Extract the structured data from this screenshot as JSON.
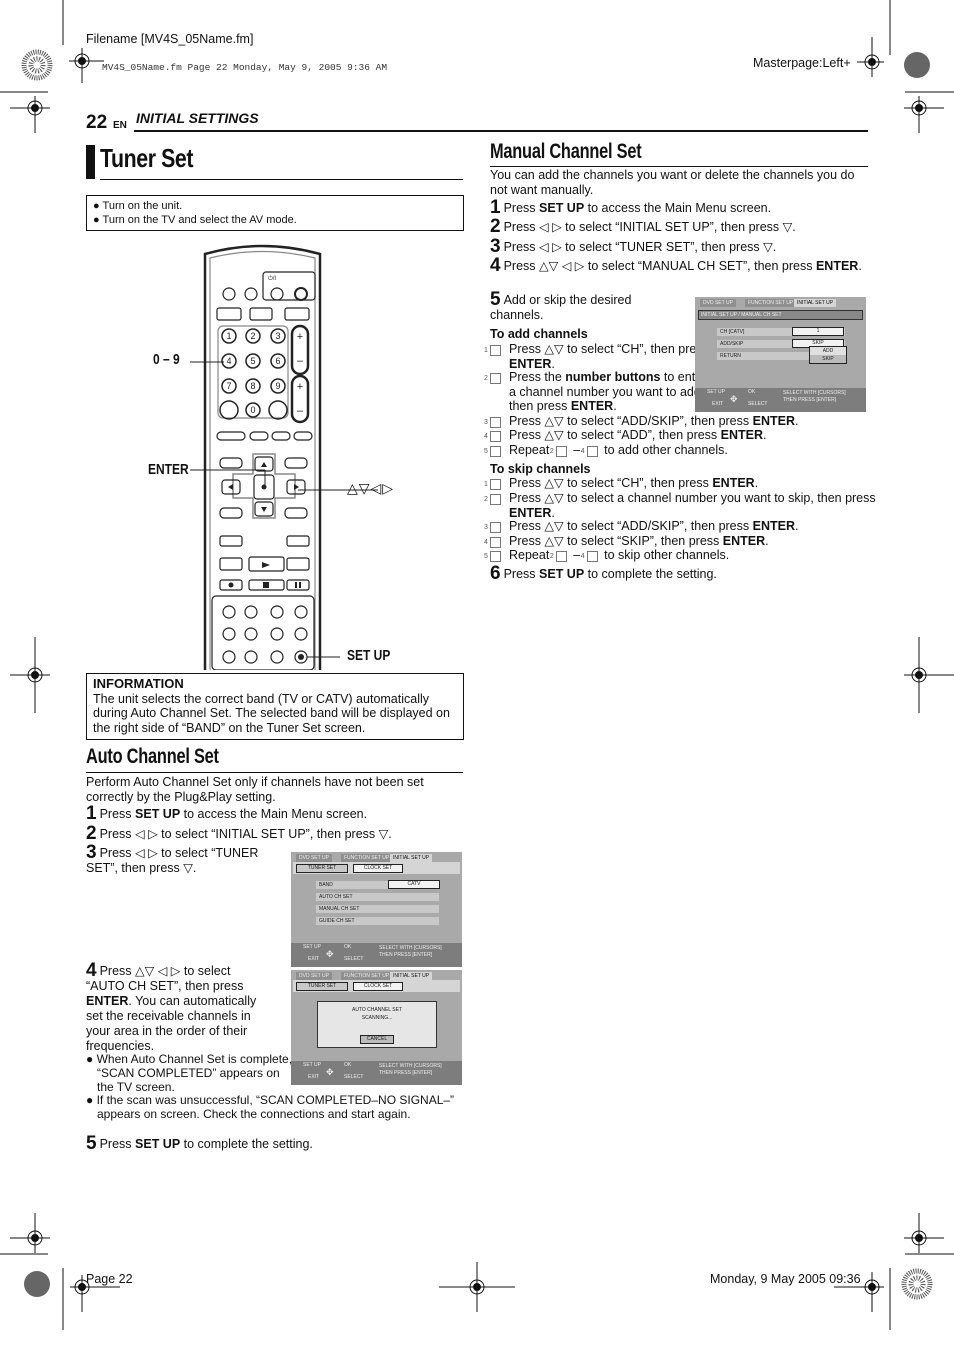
{
  "print_header": {
    "filename": "Filename [MV4S_05Name.fm]",
    "stamp": "MV4S_05Name.fm  Page 22  Monday, May 9, 2005  9:36 AM",
    "masterpage": "Masterpage:Left+"
  },
  "page_header": {
    "page_number": "22",
    "lang": "EN",
    "section": "INITIAL SETTINGS"
  },
  "tuner_set": {
    "title": "Tuner Set",
    "preparation": [
      "Turn on the unit.",
      "Turn on the TV and select the AV mode."
    ],
    "remote": {
      "power_label": "⏻/I",
      "number_keys": [
        "1",
        "2",
        "3",
        "4",
        "5",
        "6",
        "7",
        "8",
        "9",
        "0"
      ],
      "callouts": {
        "numbers": "0 – 9",
        "enter": "ENTER",
        "cursors": "△▽◁▷",
        "setup": "SET UP"
      }
    },
    "information": {
      "heading": "INFORMATION",
      "text": "The unit selects the correct band (TV or CATV) automatically during Auto Channel Set. The selected band will be displayed on the right side of “BAND” on the Tuner Set screen."
    }
  },
  "auto_channel_set": {
    "heading": "Auto Channel Set",
    "intro": "Perform Auto Channel Set only if channels have not been set correctly by the Plug&Play setting.",
    "steps": [
      {
        "n": "1",
        "pre": "Press ",
        "bold": "SET UP",
        "post": " to access the Main Menu screen."
      },
      {
        "n": "2",
        "pre": "Press ◁ ▷ to select “INITIAL SET UP”, then press ▽.",
        "bold": "",
        "post": ""
      },
      {
        "n": "3",
        "pre": "Press ◁ ▷ to select “TUNER SET”, then press ▽.",
        "bold": "",
        "post": ""
      },
      {
        "n": "4",
        "pre": "Press △▽ ◁ ▷ to select “AUTO CH SET”, then press ",
        "bold": "ENTER",
        "post": ". You can automatically set the receivable channels in your area in the order of their frequencies."
      },
      {
        "n": "5",
        "pre": "Press ",
        "bold": "SET UP",
        "post": " to complete the setting."
      }
    ],
    "notes": [
      "When Auto Channel Set is complete, “SCAN COMPLETED” appears on the TV screen.",
      "If the scan was unsuccessful, “SCAN COMPLETED–NO SIGNAL–” appears on screen. Check the connections and start again."
    ],
    "screen1": {
      "tabs": [
        "DVD SET UP",
        "FUNCTION SET UP",
        "INITIAL SET UP"
      ],
      "subtabs": [
        "TUNER SET",
        "CLOCK SET"
      ],
      "rows": [
        "BAND",
        "AUTO CH SET",
        "MANUAL CH SET",
        "GUIDE CH SET"
      ],
      "band_value": "CATV",
      "footer_left": [
        "SET UP",
        "OK",
        "EXIT",
        "SELECT"
      ],
      "footer_right": [
        "SELECT WITH [CURSORS]",
        "THEN PRESS [ENTER]"
      ]
    },
    "screen2": {
      "tabs": [
        "DVD SET UP",
        "FUNCTION SET UP",
        "INITIAL SET UP"
      ],
      "subtabs": [
        "TUNER SET",
        "CLOCK SET"
      ],
      "dialog_title": "AUTO CHANNEL SET",
      "dialog_status": "SCANNING...",
      "cancel": "CANCEL",
      "footer_left": [
        "SET UP",
        "OK",
        "EXIT",
        "SELECT"
      ],
      "footer_right": [
        "SELECT WITH [CURSORS]",
        "THEN PRESS [ENTER]"
      ]
    }
  },
  "manual_channel_set": {
    "heading": "Manual Channel Set",
    "intro": "You can add the channels you want or delete the channels you do not want manually.",
    "steps": [
      {
        "n": "1",
        "pre": "Press ",
        "bold": "SET UP",
        "post": " to access the Main Menu screen."
      },
      {
        "n": "2",
        "pre": "Press ◁ ▷ to select “INITIAL SET UP”, then press ▽.",
        "bold": "",
        "post": ""
      },
      {
        "n": "3",
        "pre": "Press ◁ ▷ to select “TUNER SET”, then press ▽.",
        "bold": "",
        "post": ""
      },
      {
        "n": "4",
        "pre": "Press △▽ ◁ ▷ to select “MANUAL CH SET”, then press ",
        "bold": "ENTER",
        "post": "."
      },
      {
        "n": "5",
        "pre": "Add or skip the desired channels.",
        "bold": "",
        "post": ""
      },
      {
        "n": "6",
        "pre": "Press ",
        "bold": "SET UP",
        "post": " to complete the setting."
      }
    ],
    "add_heading": "To add channels",
    "add_steps": [
      {
        "n": "1",
        "pre": "Press △▽ to select “CH”, then press ",
        "bold": "ENTER",
        "post": "."
      },
      {
        "n": "2",
        "pre": "Press the ",
        "bold": "number buttons",
        "post": " to enter a channel number you want to add, then press ",
        "bold2": "ENTER",
        "post2": "."
      },
      {
        "n": "3",
        "pre": "Press △▽ to select “ADD/SKIP”, then press ",
        "bold": "ENTER",
        "post": "."
      },
      {
        "n": "4",
        "pre": "Press △▽ to select “ADD”, then press ",
        "bold": "ENTER",
        "post": "."
      },
      {
        "n": "5",
        "pre": "Repeat ",
        "r1": "2",
        "mid": " – ",
        "r2": "4",
        "post": " to add other channels."
      }
    ],
    "skip_heading": "To skip channels",
    "skip_steps": [
      {
        "n": "1",
        "pre": "Press △▽ to select “CH”, then press ",
        "bold": "ENTER",
        "post": "."
      },
      {
        "n": "2",
        "pre": "Press △▽ to select a channel number you want to skip, then press ",
        "bold": "ENTER",
        "post": "."
      },
      {
        "n": "3",
        "pre": "Press △▽ to select “ADD/SKIP”, then press ",
        "bold": "ENTER",
        "post": "."
      },
      {
        "n": "4",
        "pre": "Press △▽ to select “SKIP”, then press ",
        "bold": "ENTER",
        "post": "."
      },
      {
        "n": "5",
        "pre": "Repeat ",
        "r1": "2",
        "mid": " – ",
        "r2": "4",
        "post": " to skip other channels."
      }
    ],
    "screen": {
      "tabs": [
        "DVD SET UP",
        "FUNCTION SET UP",
        "INITIAL SET UP"
      ],
      "breadcrumb": "INITIAL SET UP / MANUAL CH SET",
      "rows": [
        "CH [CATV]",
        "ADD/SKIP",
        "RETURN"
      ],
      "ch_value": "1",
      "addskip_value": "SKIP",
      "dropdown": [
        "ADD",
        "SKIP"
      ],
      "footer_left": [
        "SET UP",
        "OK",
        "EXIT",
        "SELECT"
      ],
      "footer_right": [
        "SELECT WITH [CURSORS]",
        "THEN PRESS [ENTER]"
      ]
    }
  },
  "print_footer": {
    "page": "Page 22",
    "date": "Monday, 9 May 2005  09:36"
  }
}
